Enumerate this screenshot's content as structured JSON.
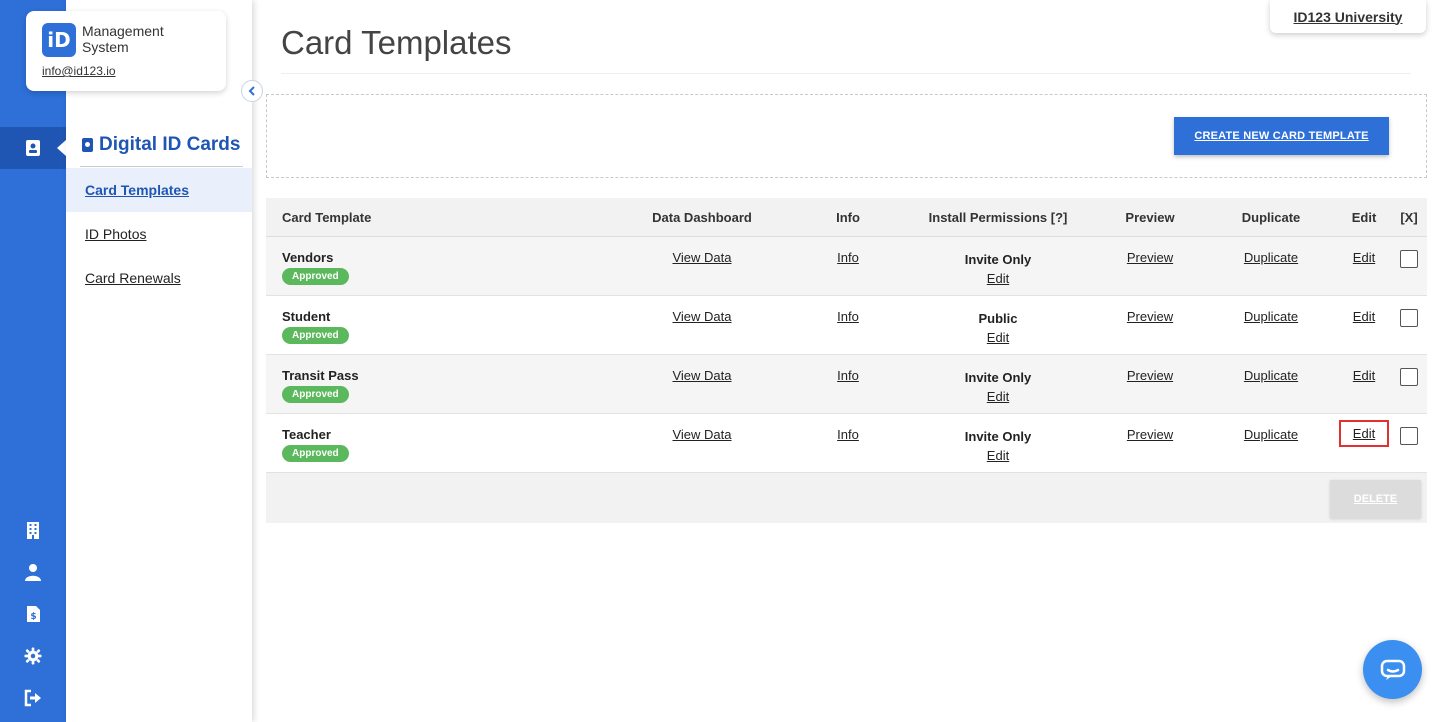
{
  "brand": {
    "logo_letters": "iD",
    "name": "Management System",
    "email": "info@id123.io"
  },
  "org": {
    "name": "ID123 University"
  },
  "rail": {
    "icons": [
      "id-card-icon",
      "building-icon",
      "user-icon",
      "invoice-icon",
      "gear-icon",
      "logout-icon"
    ]
  },
  "subnav": {
    "title": "Digital ID Cards",
    "items": [
      {
        "label": "Card Templates",
        "active": true
      },
      {
        "label": "ID Photos",
        "active": false
      },
      {
        "label": "Card Renewals",
        "active": false
      }
    ]
  },
  "page": {
    "title": "Card Templates",
    "create_label": "CREATE NEW CARD TEMPLATE",
    "delete_label": "DELETE"
  },
  "table": {
    "headers": {
      "template": "Card Template",
      "dashboard": "Data Dashboard",
      "info": "Info",
      "permissions": "Install Permissions [?]",
      "preview": "Preview",
      "duplicate": "Duplicate",
      "edit": "Edit",
      "select": "[X]"
    },
    "rows": [
      {
        "name": "Vendors",
        "status": "Approved",
        "dashboard": "View Data",
        "info": "Info",
        "permission": "Invite Only",
        "perm_edit": "Edit",
        "preview": "Preview",
        "duplicate": "Duplicate",
        "edit": "Edit"
      },
      {
        "name": "Student",
        "status": "Approved",
        "dashboard": "View Data",
        "info": "Info",
        "permission": "Public",
        "perm_edit": "Edit",
        "preview": "Preview",
        "duplicate": "Duplicate",
        "edit": "Edit"
      },
      {
        "name": "Transit Pass",
        "status": "Approved",
        "dashboard": "View Data",
        "info": "Info",
        "permission": "Invite Only",
        "perm_edit": "Edit",
        "preview": "Preview",
        "duplicate": "Duplicate",
        "edit": "Edit"
      },
      {
        "name": "Teacher",
        "status": "Approved",
        "dashboard": "View Data",
        "info": "Info",
        "permission": "Invite Only",
        "perm_edit": "Edit",
        "preview": "Preview",
        "duplicate": "Duplicate",
        "edit": "Edit"
      }
    ]
  },
  "colors": {
    "primary": "#2e6fd8",
    "approved": "#5cb85c",
    "highlight": "#e03131"
  }
}
